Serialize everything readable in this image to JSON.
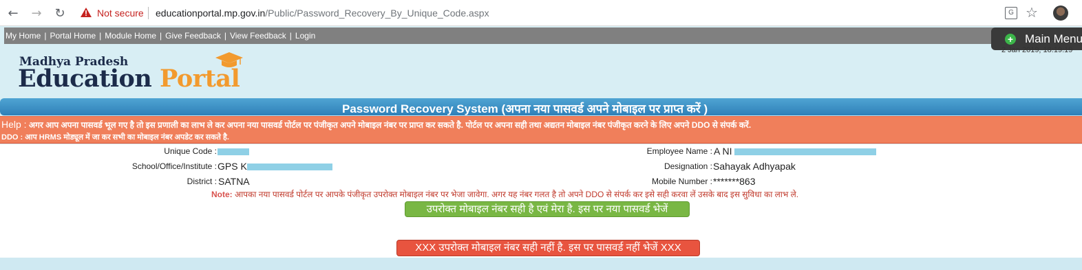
{
  "browser": {
    "security_label": "Not secure",
    "url_host": "educationportal.mp.gov.in",
    "url_path": "/Public/Password_Recovery_By_Unique_Code.aspx",
    "translate_glyph": "G"
  },
  "nav_links": [
    "My Home",
    "Portal Home",
    "Module Home",
    "Give Feedback",
    "View Feedback",
    "Login"
  ],
  "main_menu": {
    "label": "Main Menu"
  },
  "datetime": "2 Jan 2019, 18:19:19",
  "logo": {
    "line1": "Madhya Pradesh",
    "word1": "Education",
    "word2": "Portal"
  },
  "title": "Password Recovery System (अपना नया पासवर्ड अपने मोबाइल पर प्राप्त करें )",
  "help": {
    "label": "Help :",
    "text": "अगर आप अपना पासवर्ड भूल गए है तो इस प्रणाली का लाभ ले कर अपना नया पासवर्ड पोर्टल पर पंजीकृत अपने मोबाइल नंबर पर प्राप्त कर सकते है. पोर्टल पर अपना सही तथा अद्यतन मोबाइल नंबर पंजीकृत करने के लिए अपने DDO से संपर्क करें.",
    "ddo_text": "DDO : आप HRMS मोड्यूल में जा कर सभी का मोबाइल नंबर अपडेट कर सकते है."
  },
  "fields": {
    "unique_code": {
      "label": "Unique Code :",
      "value": ""
    },
    "school": {
      "label": "School/Office/Institute :",
      "value": "GPS K"
    },
    "district": {
      "label": "District :",
      "value": "SATNA"
    },
    "employee_name": {
      "label": "Employee Name :",
      "value": "A NI"
    },
    "designation": {
      "label": "Designation :",
      "value": "Sahayak Adhyapak"
    },
    "mobile": {
      "label": "Mobile Number :",
      "value": "*******863"
    }
  },
  "note": {
    "label": "Note:",
    "text": "आपका नया पासवर्ड पोर्टल पर आपके पंजीकृत उपरोक्त मोबाइल नंबर पर भेजा जावेगा. अगर यह नंबर गलत है तो अपने DDO से संपर्क कर इसे सही करवा लें उसके बाद इस सुविधा का लाभ ले."
  },
  "buttons": {
    "confirm": "उपरोक्त मोबाइल नंबर सही  है एवं मेरा है. इस पर नया पासवर्ड भेजें",
    "reject": "XXX उपरोक्त मोबाइल नंबर सही नहीं है. इस पर पासवर्ड नहीं भेजें XXX"
  },
  "colors": {
    "help_bg": "#f07f5b",
    "title_bg": "#3a8fc6",
    "confirm_bg": "#79b744",
    "reject_bg": "#e8543f",
    "logo_orange": "#f29a2e"
  }
}
